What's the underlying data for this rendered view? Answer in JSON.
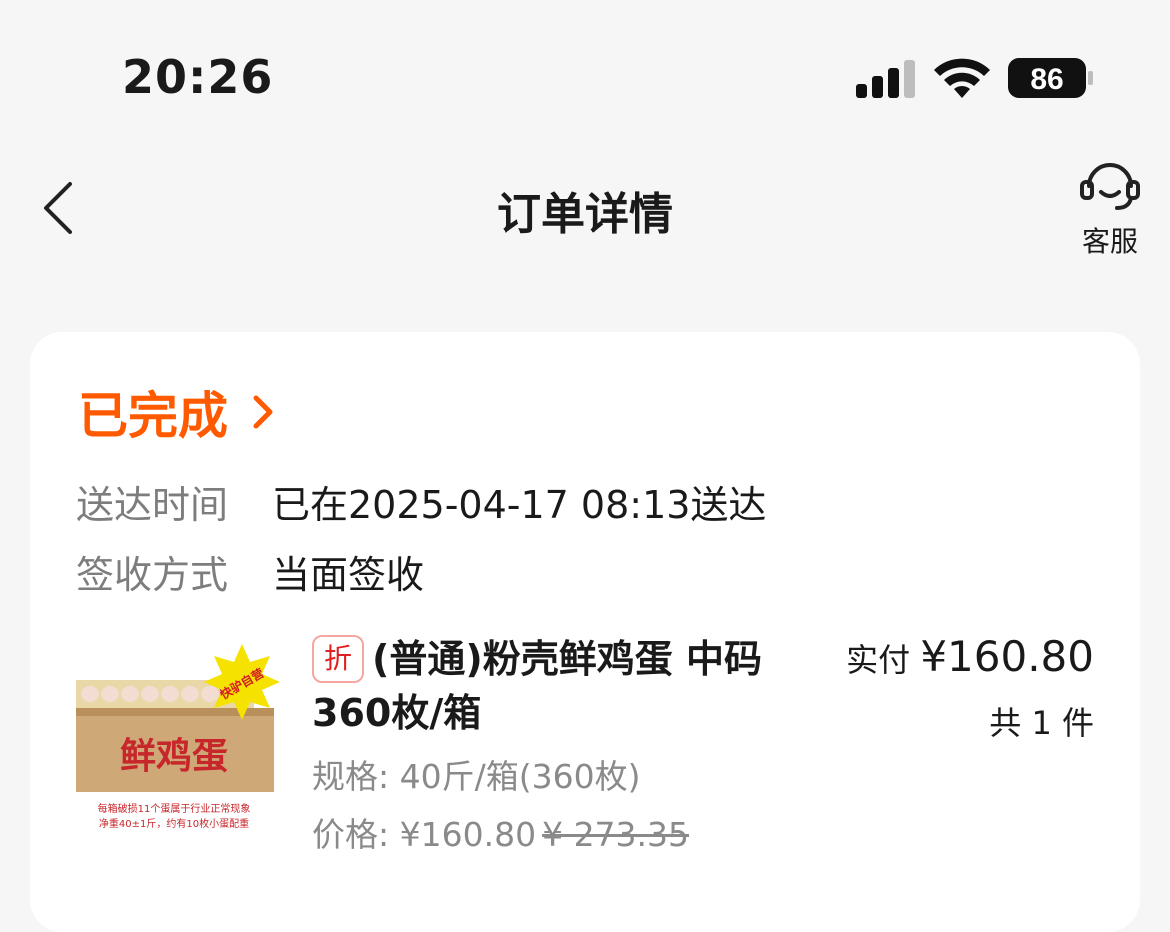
{
  "status_bar": {
    "time": "20:26",
    "battery": "86",
    "signal_icon": "cellular-signal-icon",
    "wifi_icon": "wifi-icon"
  },
  "nav": {
    "title": "订单详情",
    "back_icon": "back-chevron-icon",
    "service_label": "客服",
    "service_icon": "headset-icon"
  },
  "order": {
    "status": "已完成",
    "status_color": "#ff5a00",
    "rows": [
      {
        "label": "送达时间",
        "value": "已在2025-04-17 08:13送达"
      },
      {
        "label": "签收方式",
        "value": "当面签收"
      }
    ]
  },
  "product": {
    "tag": "折",
    "title": "(普通)粉壳鲜鸡蛋 中码 360枚/箱",
    "spec_label": "规格: ",
    "spec": "40斤/箱(360枚)",
    "price_label": "价格: ",
    "price": "¥160.80",
    "original_price": "¥ 273.35",
    "paid_label": "实付 ",
    "paid_amount": "¥160.80",
    "quantity": "共 1 件",
    "image": {
      "box_text": "鲜鸡蛋",
      "star_text": "快驴自营",
      "note_line1": "每箱破损11个蛋属于行业正常现象",
      "note_line2": "净重40±1斤，约有10枚小蛋配重"
    }
  }
}
